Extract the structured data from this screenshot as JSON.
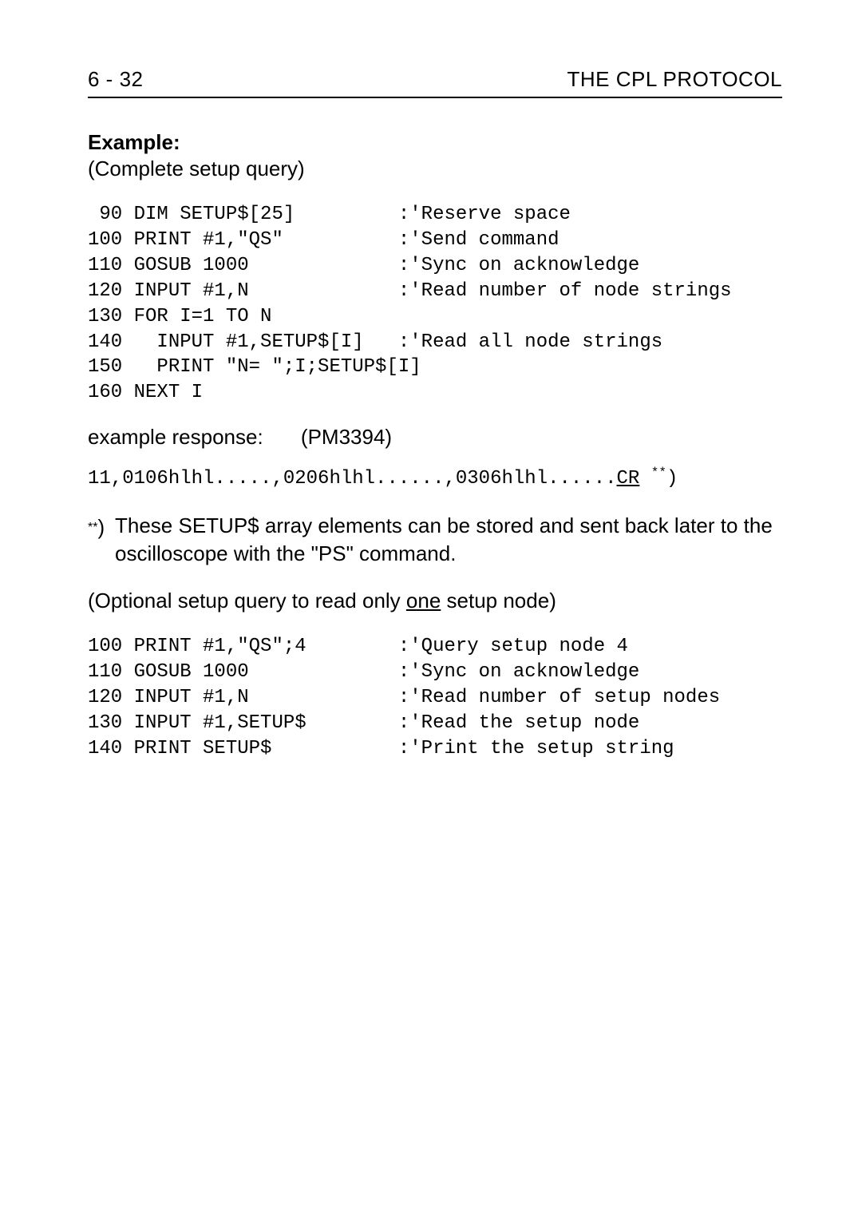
{
  "header": {
    "page_number": "6 - 32",
    "title": "THE CPL PROTOCOL"
  },
  "example_label": "Example:",
  "subtitle": "(Complete setup query)",
  "code1": " 90 DIM SETUP$[25]         :'Reserve space\n100 PRINT #1,\"QS\"          :'Send command\n110 GOSUB 1000             :'Sync on acknowledge\n120 INPUT #1,N             :'Read number of node strings\n130 FOR I=1 TO N\n140   INPUT #1,SETUP$[I]   :'Read all node strings\n150   PRINT \"N= \";I;SETUP$[I]\n160 NEXT I",
  "response_label": "example response:",
  "response_model": "(PM3394)",
  "response_prefix": "11,0106hlhl.....,0206hlhl......,0306hlhl......",
  "response_cr": "CR",
  "response_star": "**",
  "response_close": ")",
  "footnote_star": "**",
  "footnote_paren": ")",
  "footnote_text": "These SETUP$ array elements can be stored and sent back later to the oscilloscope with the \"PS\" command.",
  "optional_pre": "(Optional setup query to read only ",
  "optional_underlined": "one",
  "optional_post": " setup node)",
  "code2": "100 PRINT #1,\"QS\";4        :'Query setup node 4\n110 GOSUB 1000             :'Sync on acknowledge\n120 INPUT #1,N             :'Read number of setup nodes\n130 INPUT #1,SETUP$        :'Read the setup node\n140 PRINT SETUP$           :'Print the setup string"
}
